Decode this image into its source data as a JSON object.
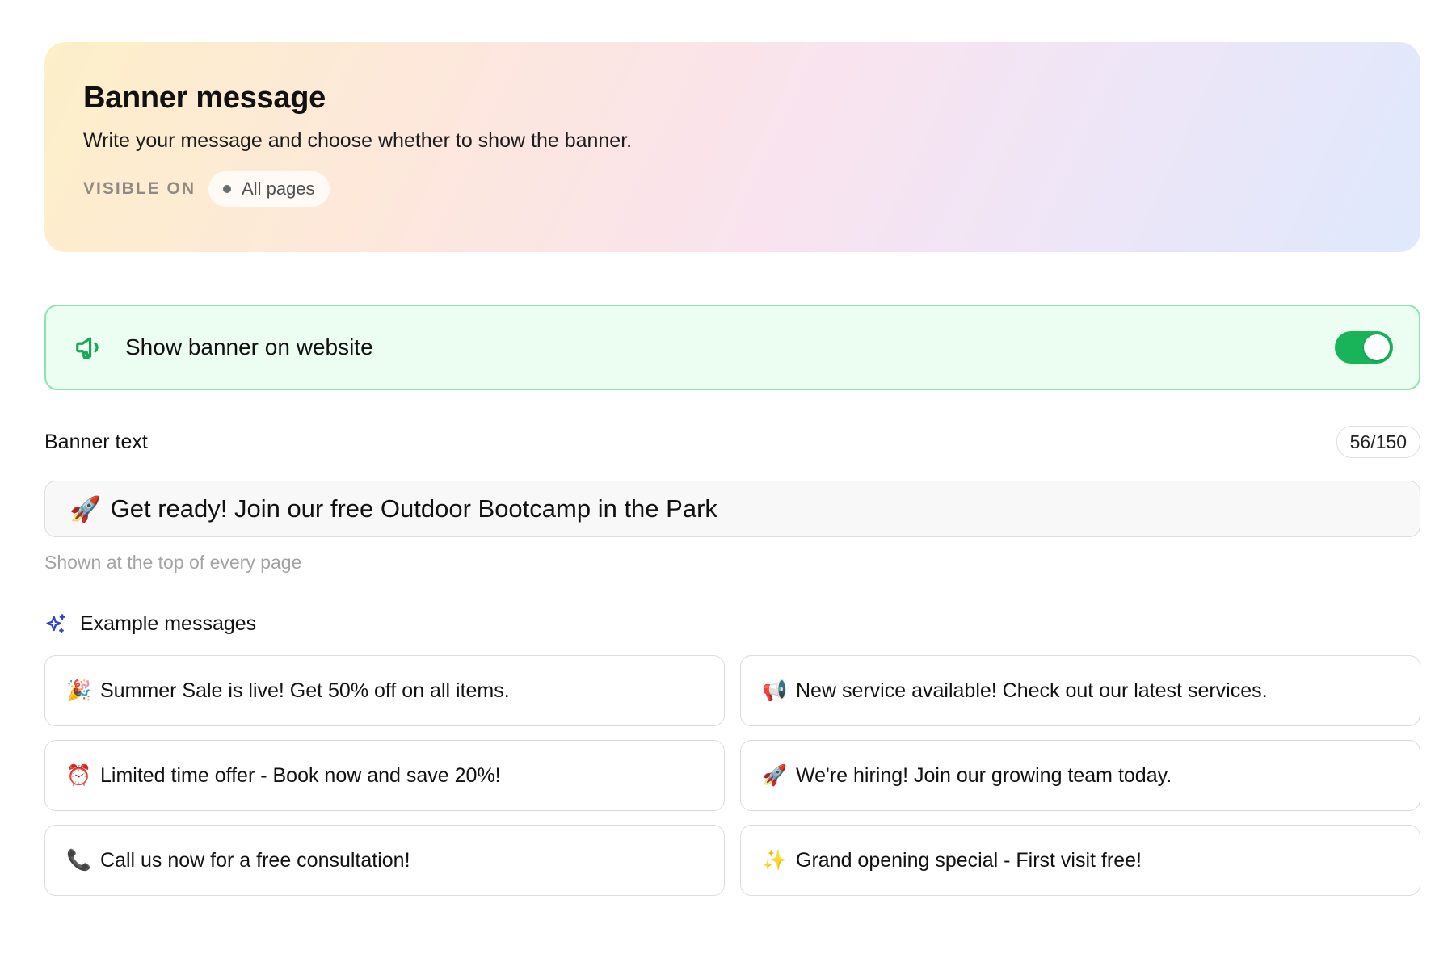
{
  "header": {
    "title": "Banner message",
    "subtitle": "Write your message and choose whether to show the banner.",
    "visible_on_label": "VISIBLE ON",
    "visible_on_value": "All pages"
  },
  "toggle": {
    "label": "Show banner on website",
    "enabled": true,
    "icon": "megaphone-icon",
    "accent_color": "#19b35a"
  },
  "banner_text": {
    "label": "Banner text",
    "counter": "56/150",
    "emoji": "🚀",
    "value": "Get ready! Join our free Outdoor Bootcamp in the Park",
    "hint": "Shown at the top of every page"
  },
  "examples": {
    "title": "Example messages",
    "icon": "sparkles-icon",
    "items": [
      {
        "emoji": "🎉",
        "text": "Summer Sale is live! Get 50% off on all items."
      },
      {
        "emoji": "📢",
        "text": "New service available! Check out our latest services."
      },
      {
        "emoji": "⏰",
        "text": "Limited time offer - Book now and save 20%!"
      },
      {
        "emoji": "🚀",
        "text": "We're hiring! Join our growing team today."
      },
      {
        "emoji": "📞",
        "text": "Call us now for a free consultation!"
      },
      {
        "emoji": "✨",
        "text": "Grand opening special - First visit free!"
      }
    ]
  }
}
